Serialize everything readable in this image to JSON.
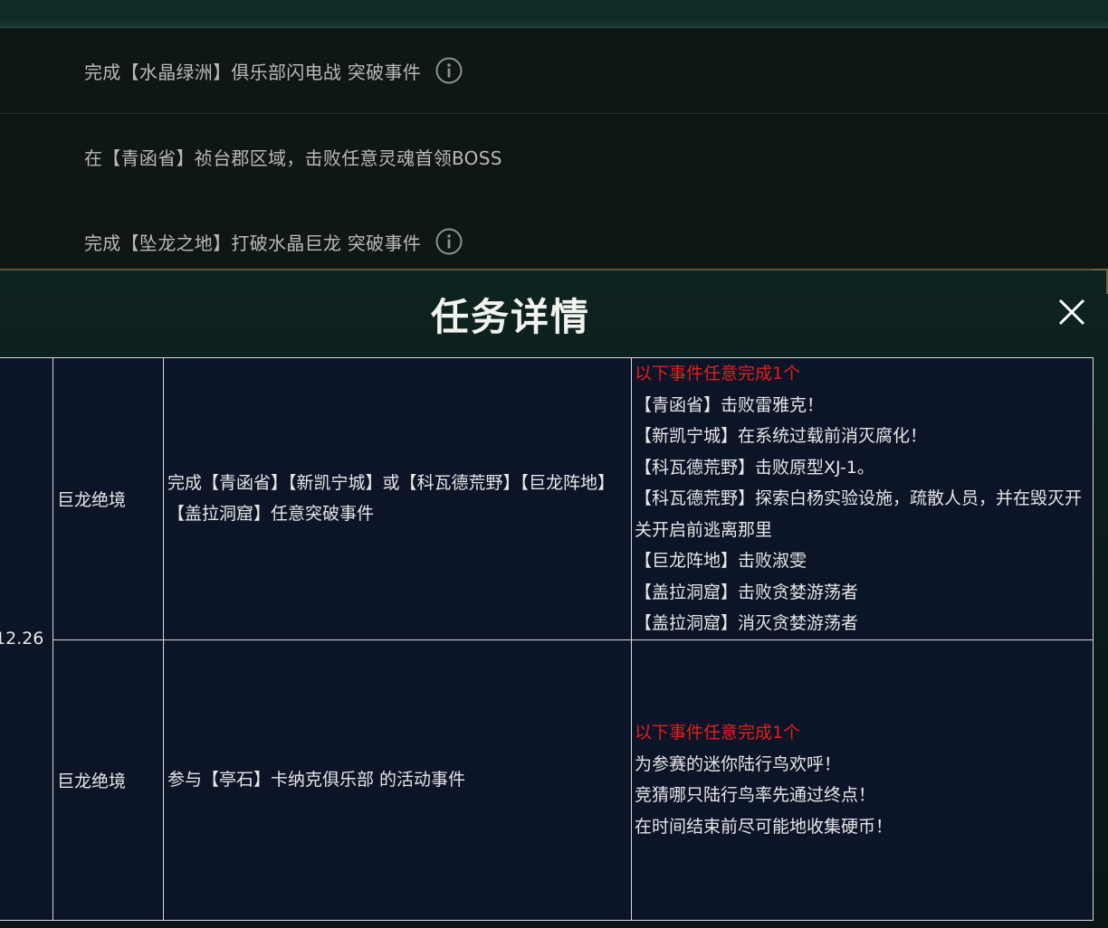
{
  "task_list": {
    "rows": [
      {
        "text": "完成【水晶绿洲】俱乐部闪电战 突破事件",
        "has_info": true
      },
      {
        "text": "在【青函省】祯台郡区域，击败任意灵魂首领BOSS",
        "has_info": false
      },
      {
        "text": "完成【坠龙之地】打破水晶巨龙 突破事件",
        "has_info": true
      }
    ]
  },
  "dialog": {
    "title": "任务详情",
    "close_icon": "close-icon"
  },
  "table": {
    "date": "12.26",
    "rows": [
      {
        "zone": "巨龙绝境",
        "requirement": "完成【青函省】【新凯宁城】或【科瓦德荒野】【巨龙阵地】【盖拉洞窟】任意突破事件",
        "events_header": "以下事件任意完成1个",
        "events": [
          "【青函省】击败雷雅克！",
          "【新凯宁城】在系统过载前消灭腐化！",
          "【科瓦德荒野】击败原型XJ-1。",
          "【科瓦德荒野】探索白杨实验设施，疏散人员，并在毁灭开关开启前逃离那里",
          "【巨龙阵地】击败淑雯",
          "【盖拉洞窟】击败贪婪游荡者",
          "【盖拉洞窟】消灭贪婪游荡者"
        ]
      },
      {
        "zone": "巨龙绝境",
        "requirement": "参与【亭石】卡纳克俱乐部 的活动事件",
        "events_header": "以下事件任意完成1个",
        "events": [
          "为参赛的迷你陆行鸟欢呼！",
          "竞猜哪只陆行鸟率先通过终点！",
          "在时间结束前尽可能地收集硬币！"
        ]
      }
    ]
  },
  "colors": {
    "highlight_red": "#e3201e",
    "table_bg": "#0c1428",
    "dialog_bg": "#0e2420"
  }
}
